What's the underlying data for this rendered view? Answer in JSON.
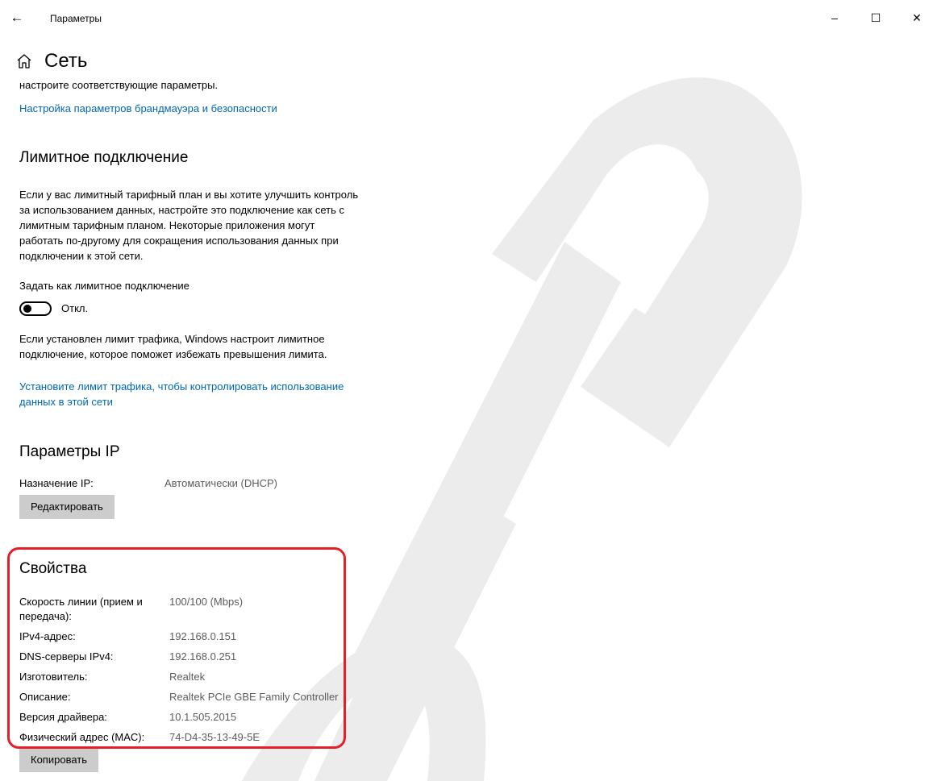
{
  "window": {
    "title": "Параметры",
    "back_icon": "←",
    "minimize_icon": "–",
    "maximize_icon": "☐",
    "close_icon": "✕"
  },
  "page": {
    "title": "Сеть",
    "home_icon": "home-icon"
  },
  "firewall": {
    "intro_text": "настроите соответствующие параметры.",
    "link": "Настройка параметров брандмауэра и безопасности"
  },
  "metered": {
    "title": "Лимитное подключение",
    "description_lines": [
      "Если у вас лимитный тарифный план и вы хотите улучшить контроль",
      "за использованием данных, настройте это подключение как сеть с",
      "лимитным тарифным планом. Некоторые приложения могут",
      "работать по-другому для сокращения использования данных при",
      "подключении к этой сети."
    ],
    "toggle_caption": "Задать как лимитное подключение",
    "toggle_state": "Откл.",
    "limit_lines": [
      "Если установлен лимит трафика, Windows настроит лимитное",
      "подключение, которое поможет избежать превышения лимита."
    ],
    "limit_link_lines": [
      "Установите лимит трафика, чтобы контролировать использование",
      "данных в этой сети"
    ]
  },
  "ip": {
    "title": "Параметры IP",
    "assignment_label": "Назначение IP:",
    "assignment_value": "Автоматически (DHCP)",
    "edit_button": "Редактировать"
  },
  "properties": {
    "title": "Свойства",
    "rows": [
      {
        "label": "Скорость линии (прием и передача):",
        "value": "100/100 (Mbps)"
      },
      {
        "label": "IPv4-адрес:",
        "value": "192.168.0.151"
      },
      {
        "label": "DNS-серверы IPv4:",
        "value": "192.168.0.251"
      },
      {
        "label": "Изготовитель:",
        "value": "Realtek"
      },
      {
        "label": "Описание:",
        "value": "Realtek PCIe GBE Family Controller"
      },
      {
        "label": "Версия драйвера:",
        "value": "10.1.505.2015"
      },
      {
        "label": "Физический адрес (MAC):",
        "value": "74-D4-35-13-49-5E"
      }
    ],
    "copy_button": "Копировать"
  },
  "colors": {
    "link": "#0067b8",
    "highlight": "#e3202a",
    "button_bg": "#cccccc",
    "secondary_text": "#5c5c5c"
  }
}
